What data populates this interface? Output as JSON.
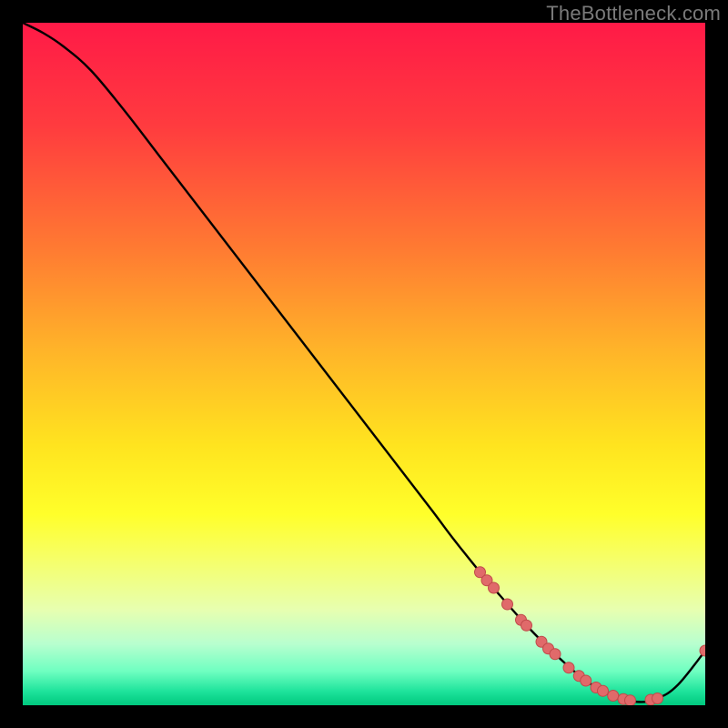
{
  "watermark": {
    "text": "TheBottleneck.com"
  },
  "colors": {
    "curve": "#000000",
    "dot_fill": "#e06a6a",
    "dot_stroke": "#c04a4a",
    "gradient_top": "#ff1a47",
    "gradient_bottom": "#00c87e"
  },
  "chart_data": {
    "type": "line",
    "title": "",
    "xlabel": "",
    "ylabel": "",
    "xlim": [
      0,
      100
    ],
    "ylim": [
      0,
      100
    ],
    "grid": false,
    "legend": false,
    "series": [
      {
        "name": "curve",
        "kind": "line",
        "x": [
          0,
          3,
          6,
          10,
          15,
          20,
          25,
          30,
          35,
          40,
          45,
          50,
          55,
          60,
          63,
          67,
          70,
          74,
          78,
          82,
          86,
          90,
          93,
          96,
          100
        ],
        "y": [
          100,
          98.5,
          96.5,
          93,
          87,
          80.5,
          74,
          67.5,
          61,
          54.5,
          48,
          41.5,
          35,
          28.5,
          24.5,
          19.5,
          16,
          11.5,
          7.5,
          4,
          1.5,
          0.5,
          1,
          3,
          8
        ]
      },
      {
        "name": "markers",
        "kind": "scatter",
        "x": [
          67,
          68,
          69,
          71,
          73,
          73.8,
          76,
          77,
          78,
          80,
          81.5,
          82.5,
          84,
          85,
          86.5,
          88,
          89,
          92,
          93,
          100
        ],
        "y": [
          19.5,
          18.3,
          17.2,
          14.8,
          12.5,
          11.7,
          9.3,
          8.3,
          7.5,
          5.5,
          4.3,
          3.6,
          2.6,
          2.1,
          1.4,
          0.9,
          0.7,
          0.8,
          1,
          8
        ]
      }
    ]
  }
}
